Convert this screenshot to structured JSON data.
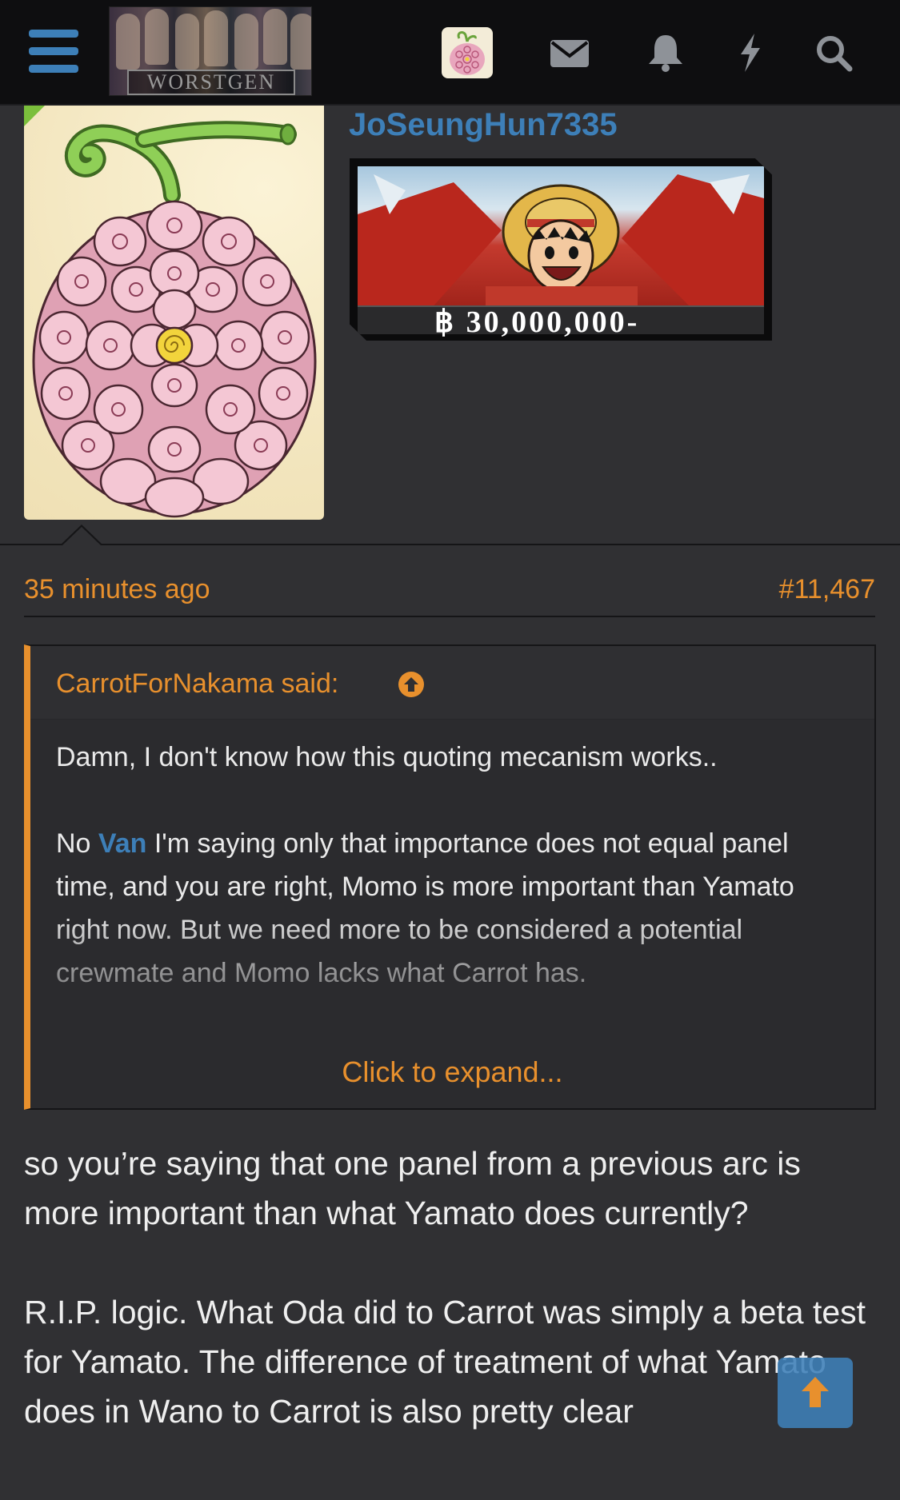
{
  "header": {
    "logo_text": "WORSTGEN",
    "icons": [
      "menu-icon",
      "user-avatar",
      "mail-icon",
      "bell-icon",
      "bolt-icon",
      "search-icon"
    ]
  },
  "post": {
    "username": "JoSeungHun7335",
    "bounty_amount": "฿ 30,000,000-",
    "timestamp": "35 minutes ago",
    "post_number": "#11,467",
    "quote": {
      "author": "CarrotForNakama said:",
      "line1": "Damn, I don't know how this quoting mecanism works..",
      "para2_before": "No ",
      "mention": "Van",
      "para2_after": " I'm saying only that importance does not equal panel time, and you are right, Momo is more important than Yamato right now. But we need more to be considered a potential crewmate and Momo lacks what Carrot has.",
      "expand_label": "Click to expand..."
    },
    "reply": {
      "para1": "so you’re saying that one panel from a previous arc is more important than what Yamato does currently?",
      "para2": "R.I.P. logic. What Oda did to Carrot was simply a beta test for Yamato. The difference of treatment of what Yamato does in Wano to Carrot is also pretty clear"
    }
  },
  "colors": {
    "accent_orange": "#e8902d",
    "accent_blue": "#3d7fb8",
    "background": "#303033",
    "topbar": "#0e0e10"
  }
}
